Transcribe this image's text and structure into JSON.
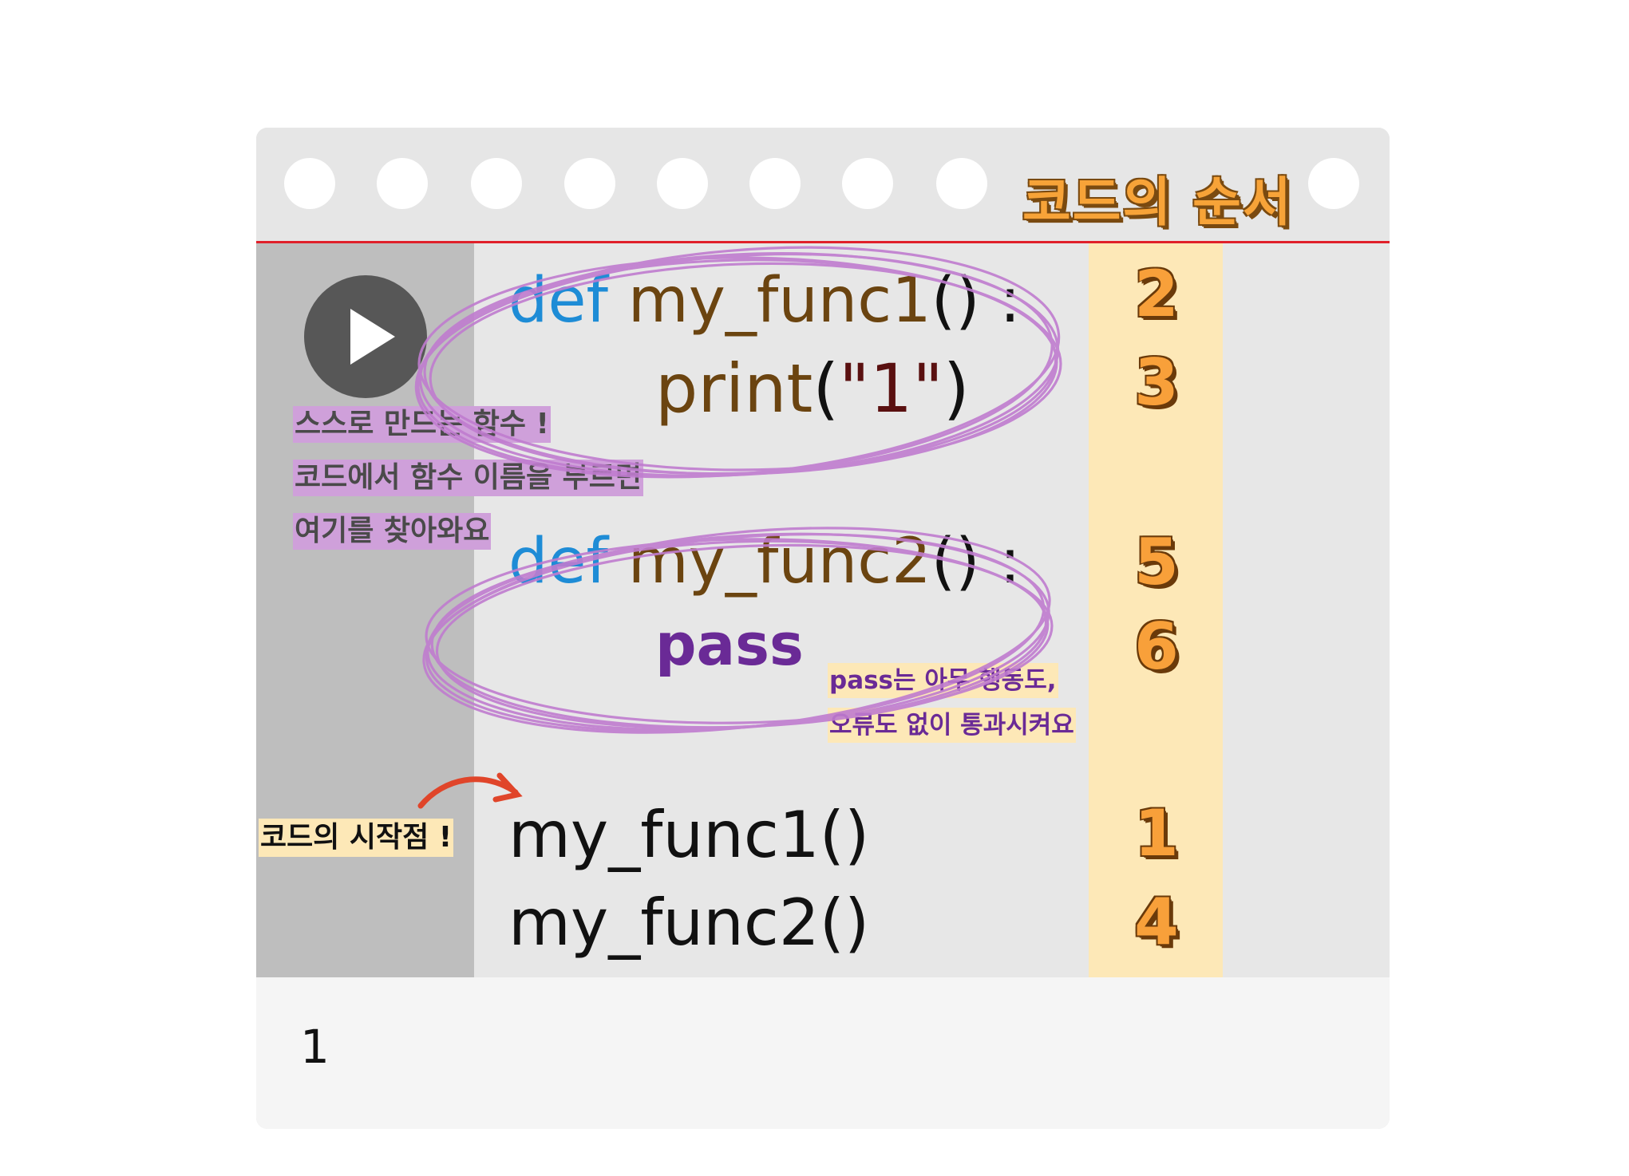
{
  "header": {
    "title": "코드의 순서"
  },
  "gutter": {
    "play_icon": "play-icon",
    "note_lines": [
      "스스로 만드는 함수 !",
      "코드에서 함수 이름을 부르면",
      "여기를 찾아와요"
    ],
    "start_note": "코드의 시작점 !"
  },
  "code": {
    "line1": {
      "keyword": "def",
      "name": "my_func1",
      "parens": "()",
      "colon": ":"
    },
    "line2": {
      "func": "print",
      "open": "(",
      "string": "\"1\"",
      "close": ")"
    },
    "line3": {
      "keyword": "def",
      "name": "my_func2",
      "parens": "()",
      "colon": ":"
    },
    "line4": {
      "statement": "pass"
    },
    "line5": {
      "call": "my_func1()"
    },
    "line6": {
      "call": "my_func2()"
    }
  },
  "pass_note": [
    "pass는 아무 행동도,",
    "오류도 없이 통과시켜요"
  ],
  "order": {
    "n1": "2",
    "n2": "3",
    "n3": "5",
    "n4": "6",
    "n5": "1",
    "n6": "4"
  },
  "output": {
    "text": "1"
  },
  "colors": {
    "highlight_circle": "#c07ccf",
    "order_bg": "#fde8b7",
    "accent_red": "#e0202a",
    "arrow": "#e0452a"
  }
}
